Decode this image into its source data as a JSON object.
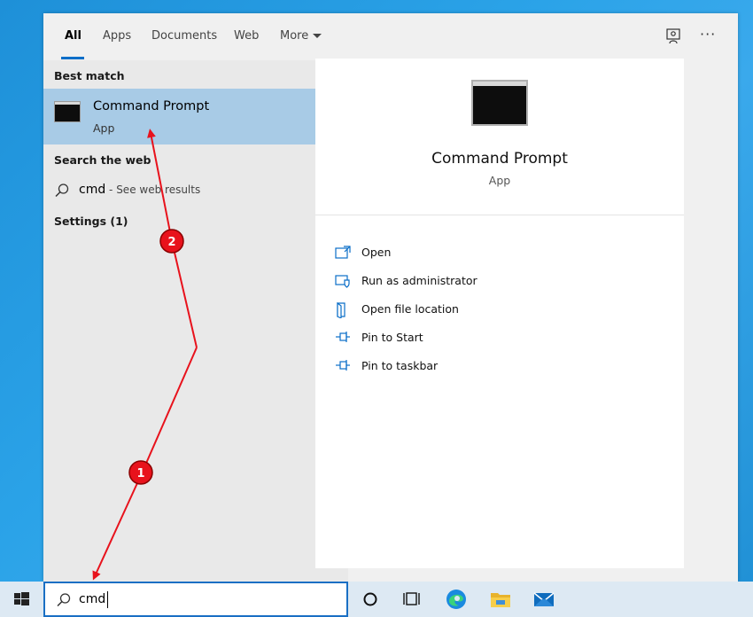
{
  "tabs": [
    {
      "label": "All",
      "active": true
    },
    {
      "label": "Apps",
      "active": false
    },
    {
      "label": "Documents",
      "active": false
    },
    {
      "label": "Web",
      "active": false
    },
    {
      "label": "More",
      "active": false
    }
  ],
  "header_icons": [
    "feedback-icon",
    "more-options-icon"
  ],
  "more_options_glyph": "···",
  "results": {
    "best_match_header": "Best match",
    "best_match": {
      "title": "Command Prompt",
      "subtitle": "App",
      "icon": "command-prompt-icon"
    },
    "search_web_header": "Search the web",
    "web_result": {
      "query": "cmd",
      "suffix": " - See web results"
    },
    "settings_header": "Settings (1)"
  },
  "detail": {
    "title": "Command Prompt",
    "subtitle": "App",
    "actions": [
      {
        "label": "Open",
        "icon": "open-icon"
      },
      {
        "label": "Run as administrator",
        "icon": "run-as-admin-icon"
      },
      {
        "label": "Open file location",
        "icon": "file-location-icon"
      },
      {
        "label": "Pin to Start",
        "icon": "pin-icon"
      },
      {
        "label": "Pin to taskbar",
        "icon": "pin-icon"
      }
    ]
  },
  "taskbar": {
    "search_value": "cmd",
    "icons": [
      "windows-start-icon",
      "search-icon",
      "cortana-icon",
      "task-view-icon",
      "edge-icon",
      "file-explorer-icon",
      "mail-icon"
    ]
  },
  "annotations": [
    {
      "label": "1"
    },
    {
      "label": "2"
    }
  ],
  "colors": {
    "accent": "#0a6ec8",
    "selection": "#a8cbe6",
    "annotation": "#e8121c",
    "taskbar": "#dde9f3"
  }
}
